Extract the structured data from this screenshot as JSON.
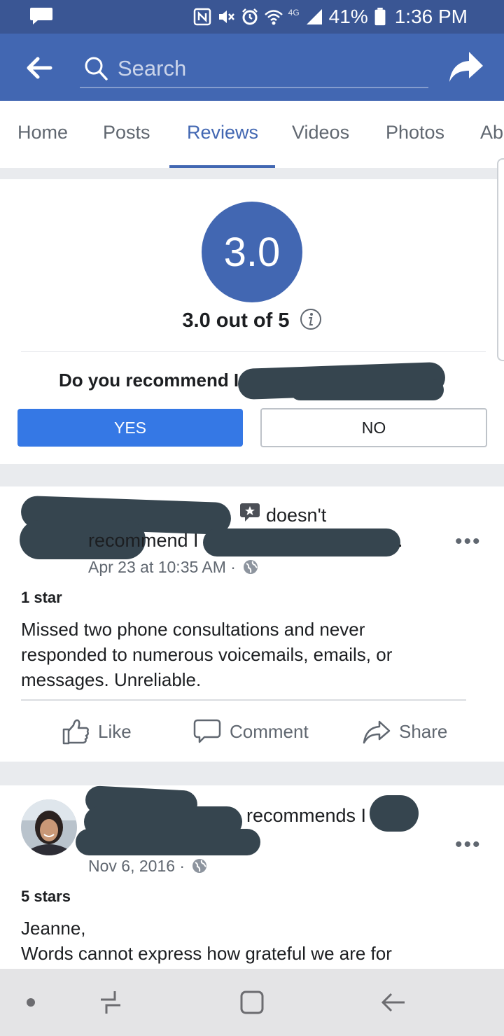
{
  "status_bar": {
    "network": "4G",
    "battery": "41%",
    "time": "1:36 PM"
  },
  "header": {
    "search_placeholder": "Search"
  },
  "tabs": [
    {
      "label": "Home",
      "active": false
    },
    {
      "label": "Posts",
      "active": false
    },
    {
      "label": "Reviews",
      "active": true
    },
    {
      "label": "Videos",
      "active": false
    },
    {
      "label": "Photos",
      "active": false
    },
    {
      "label": "Ab",
      "active": false
    }
  ],
  "rating": {
    "score": "3.0",
    "summary": "3.0 out of 5",
    "question": "Do you recommend I",
    "yes_label": "YES",
    "no_label": "NO"
  },
  "reviews": [
    {
      "action_text": "doesn't",
      "action_text_line2": "recommend I",
      "period": ".",
      "timestamp": "Apr 23 at 10:35 AM ·",
      "stars": "1 star",
      "body_lines": [
        "Missed two phone consultations and never",
        "responded to numerous voicemails, emails, or",
        "messages. Unreliable."
      ],
      "actions": {
        "like": "Like",
        "comment": "Comment",
        "share": "Share"
      }
    },
    {
      "action_text": "recommends I",
      "timestamp": "Nov 6, 2016 ·",
      "stars": "5 stars",
      "body_lines": [
        "Jeanne,",
        "Words cannot express how grateful we are for"
      ]
    }
  ],
  "colors": {
    "brand_blue": "#4267b2",
    "status_bar": "#3a5694",
    "yes_button": "#3578e5",
    "redaction": "#36454f"
  }
}
